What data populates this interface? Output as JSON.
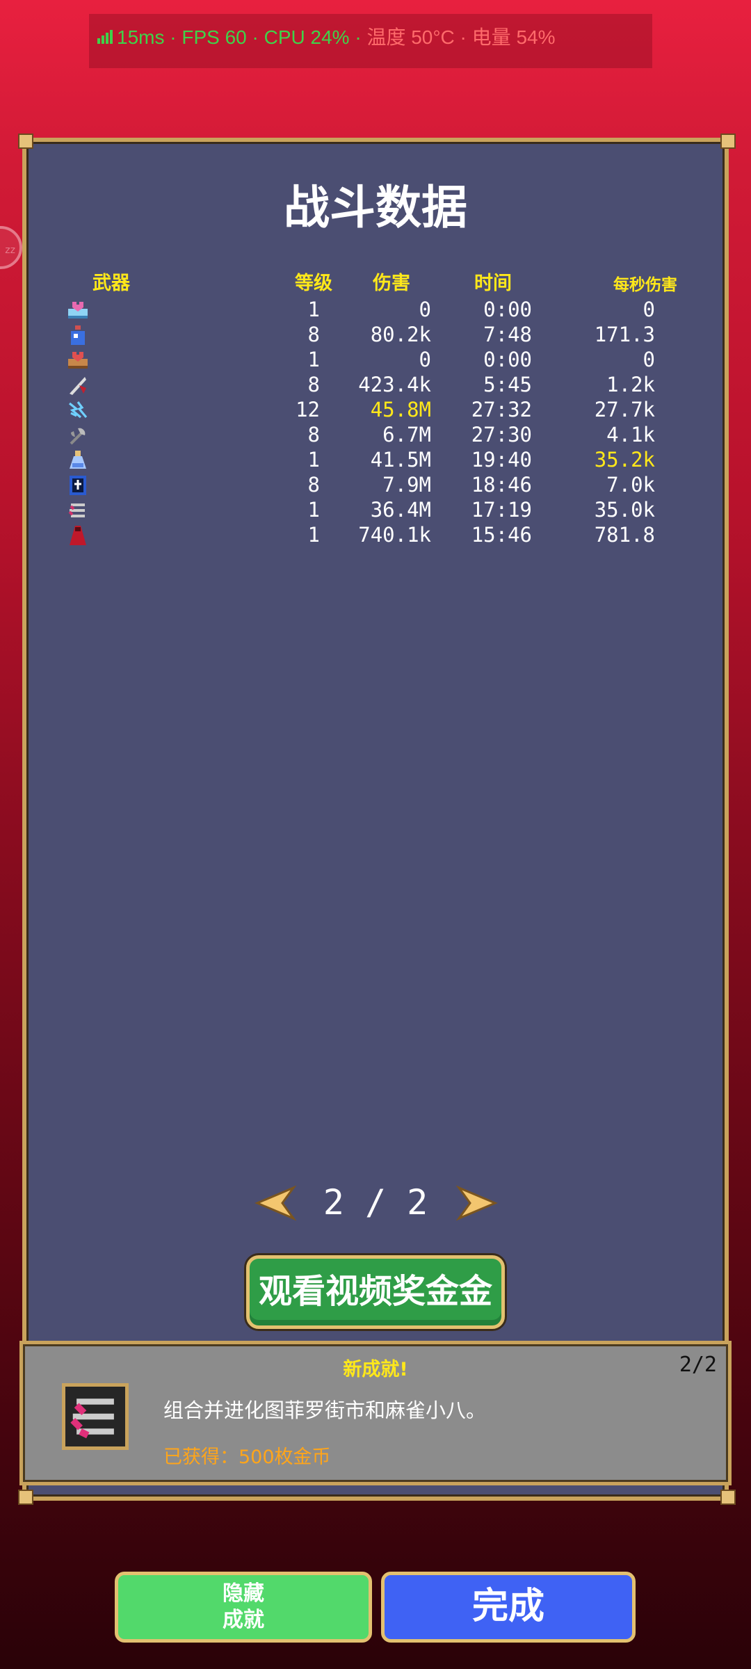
{
  "status_bar": {
    "text_left": "15ms · FPS 60 · CPU 24% · ",
    "text_right": "温度 50°C · 电量 54%"
  },
  "title": "战斗数据",
  "columns": {
    "weapon": "武器",
    "level": "等级",
    "damage": "伤害",
    "time": "时间",
    "dps": "每秒伤害"
  },
  "rows": [
    {
      "icon": "ice-cake-icon",
      "level": "1",
      "damage": "0",
      "time": "0:00",
      "dps": "0"
    },
    {
      "icon": "blue-potion-icon",
      "level": "8",
      "damage": "80.2k",
      "time": "7:48",
      "dps": "171.3"
    },
    {
      "icon": "brown-cake-icon",
      "level": "1",
      "damage": "0",
      "time": "0:00",
      "dps": "0"
    },
    {
      "icon": "feather-knife-icon",
      "level": "8",
      "damage": "423.4k",
      "time": "5:45",
      "dps": "1.2k"
    },
    {
      "icon": "lightning-icon",
      "level": "12",
      "damage": "45.8M",
      "time": "27:32",
      "dps": "27.7k",
      "highlight": "damage"
    },
    {
      "icon": "axe-icon",
      "level": "8",
      "damage": "6.7M",
      "time": "27:30",
      "dps": "4.1k"
    },
    {
      "icon": "flask-icon",
      "level": "1",
      "damage": "41.5M",
      "time": "19:40",
      "dps": "35.2k",
      "highlight": "dps"
    },
    {
      "icon": "holy-book-icon",
      "level": "8",
      "damage": "7.9M",
      "time": "18:46",
      "dps": "7.0k"
    },
    {
      "icon": "scrolls-icon",
      "level": "1",
      "damage": "36.4M",
      "time": "17:19",
      "dps": "35.0k"
    },
    {
      "icon": "red-cloak-icon",
      "level": "1",
      "damage": "740.1k",
      "time": "15:46",
      "dps": "781.8"
    }
  ],
  "pager": {
    "text": "2 / 2"
  },
  "video_button": "观看视频奖金金",
  "achievement": {
    "title": "新成就!",
    "count": "2/2",
    "description": "组合并进化图菲罗街市和麻雀小八。",
    "reward": "已获得：500枚金币"
  },
  "buttons": {
    "hide_line1": "隐藏",
    "hide_line2": "成就",
    "done": "完成"
  },
  "colors": {
    "panel": "#4b4e72",
    "border_gold": "#c9a35c",
    "header_yellow": "#ffe81a",
    "reward_orange": "#ffa51a",
    "green_button": "#2f9d47",
    "blue_button": "#3f62f4"
  }
}
